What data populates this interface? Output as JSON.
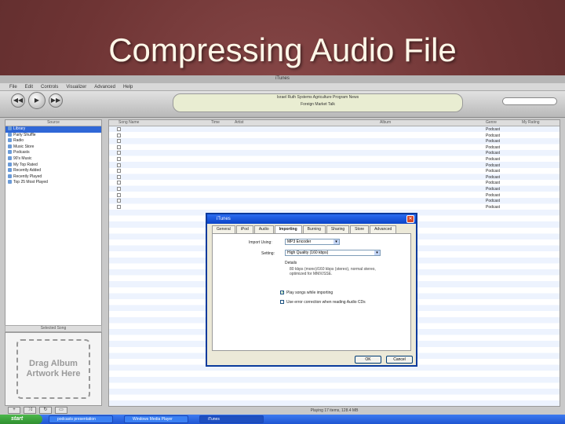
{
  "slide": {
    "title": "Compressing Audio File"
  },
  "itunes": {
    "window_title": "iTunes",
    "menu": [
      "File",
      "Edit",
      "Controls",
      "Visualizer",
      "Advanced",
      "Help"
    ],
    "lcd_line1": "Israel Ruth Systems Agriculture Program News",
    "lcd_line2": "Foreign Market Talk",
    "sidebar": {
      "header": "Source",
      "items": [
        "Library",
        "Party Shuffle",
        "Radio",
        "Music Store",
        "Podcasts",
        "90's Music",
        "My Top Rated",
        "Recently Added",
        "Recently Played",
        "Top 25 Most Played"
      ]
    },
    "artwork": {
      "header": "Selected Song",
      "text": "Drag Album Artwork Here"
    },
    "list": {
      "headers": [
        "Song Name",
        "Time",
        "Artist",
        "Album",
        "Genre",
        "My Rating"
      ],
      "genre_values": [
        "Podcast",
        "Podcast",
        "Podcast",
        "Podcast",
        "Podcast",
        "Podcast",
        "Podcast",
        "Podcast",
        "Podcast",
        "Podcast",
        "Podcast",
        "Podcast",
        "Podcast",
        "Podcast"
      ]
    },
    "status": "Playing 17 items, 128.4 MB"
  },
  "dialog": {
    "title": "iTunes",
    "tabs": [
      "General",
      "iPod",
      "Audio",
      "Importing",
      "Burning",
      "Sharing",
      "Store",
      "Advanced"
    ],
    "active_tab": "Importing",
    "import_using_label": "Import Using:",
    "import_using_value": "MP3 Encoder",
    "setting_label": "Setting:",
    "setting_value": "High Quality (160 kbps)",
    "details_label": "Details",
    "details_text": "80 kbps (mono)/160 kbps (stereo), normal stereo, optimized for MMX/SSE.",
    "play_songs_label": "Play songs while importing",
    "error_correction_label": "Use error correction when reading Audio CDs",
    "ok_label": "OK",
    "cancel_label": "Cancel"
  },
  "taskbar": {
    "start_label": "start",
    "tasks": [
      "podcasts presentation",
      "Windows Media Player",
      "iTunes"
    ]
  }
}
